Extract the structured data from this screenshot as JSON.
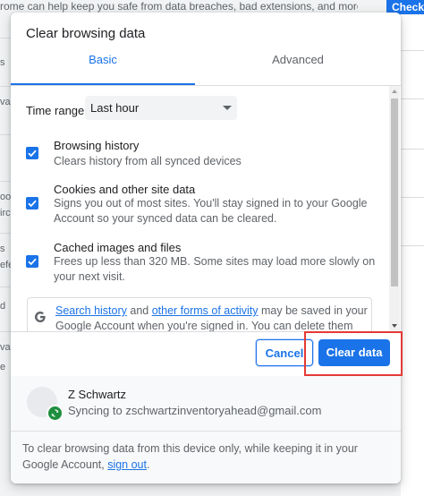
{
  "background": {
    "top_text": "rome can help keep you safe from data breaches, bad extensions, and more",
    "check_button": "Check n",
    "left_fragments": [
      "s",
      "va",
      "ook",
      "ircl",
      "s",
      "efe",
      "d",
      "va",
      "e"
    ]
  },
  "dialog": {
    "title": "Clear browsing data",
    "tabs": [
      {
        "label": "Basic",
        "selected": true
      },
      {
        "label": "Advanced",
        "selected": false
      }
    ],
    "time_range": {
      "label": "Time range",
      "value": "Last hour"
    },
    "options": [
      {
        "title": "Browsing history",
        "description": "Clears history from all synced devices",
        "checked": true
      },
      {
        "title": "Cookies and other site data",
        "description": "Signs you out of most sites. You'll stay signed in to your Google Account so your synced data can be cleared.",
        "checked": true
      },
      {
        "title": "Cached images and files",
        "description": "Frees up less than 320 MB. Some sites may load more slowly on your next visit.",
        "checked": true
      }
    ],
    "google_notice": {
      "link1": "Search history",
      "text1": " and ",
      "link2": "other forms of activity",
      "text2": " may be saved in your Google Account when you're signed in. You can delete them anytime."
    },
    "buttons": {
      "cancel": "Cancel",
      "clear": "Clear data"
    },
    "account": {
      "name": "Z Schwartz",
      "sync_text": "Syncing to zschwartzinventoryahead@gmail.com",
      "note_text": "To clear browsing data from this device only, while keeping it in your Google Account, ",
      "note_link": "sign out",
      "note_end": "."
    }
  },
  "colors": {
    "accent": "#1a73e8",
    "highlight": "#e53935",
    "sync_green": "#1e8e3e"
  }
}
